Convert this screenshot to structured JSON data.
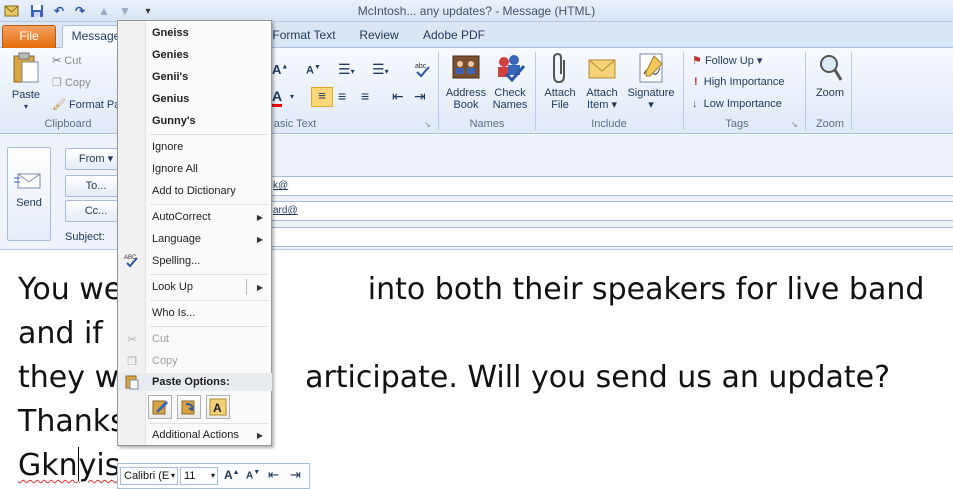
{
  "window": {
    "title": "McIntosh... any updates? - Message (HTML)"
  },
  "tabs": [
    "File",
    "Message",
    "Format Text",
    "Review",
    "Adobe PDF"
  ],
  "ribbon": {
    "clipboard": {
      "paste": "Paste",
      "cut": "Cut",
      "copy": "Copy",
      "format_painter": "Format Pa",
      "label": "Clipboard"
    },
    "basic_text": {
      "label": "asic Text"
    },
    "names": {
      "address_book": [
        "Address",
        "Book"
      ],
      "check_names": [
        "Check",
        "Names"
      ],
      "label": "Names"
    },
    "include": {
      "attach_file": [
        "Attach",
        "File"
      ],
      "attach_item": [
        "Attach",
        "Item ▾"
      ],
      "signature": [
        "Signature",
        "▾"
      ],
      "label": "Include"
    },
    "tags": {
      "follow_up": "Follow Up ▾",
      "high_importance": "High Importance",
      "low_importance": "Low Importance",
      "label": "Tags"
    },
    "zoom": {
      "zoom": "Zoom",
      "label": "Zoom"
    }
  },
  "header": {
    "send": "Send",
    "from": "From ▾",
    "to": "To...",
    "cc": "Cc...",
    "subject_label": "Subject:",
    "to_value": "k@",
    "cc_value": "ard@"
  },
  "body": {
    "line1a": "You we",
    "line1b": " into both their speakers for live band and if",
    "line2a": "they w",
    "line2b": "articipate. Will you send us an update?",
    "line3": "Thanks",
    "line4a": "Gkn",
    "line4b": "yis"
  },
  "context_menu": {
    "suggestions": [
      "Gneiss",
      "Genies",
      "Genii's",
      "Genius",
      "Gunny's"
    ],
    "ignore": "Ignore",
    "ignore_all": "Ignore All",
    "add_to_dictionary": "Add to Dictionary",
    "autocorrect": "AutoCorrect",
    "language": "Language",
    "spelling": "Spelling...",
    "look_up": "Look Up",
    "who_is": "Who Is...",
    "cut": "Cut",
    "copy": "Copy",
    "paste_options": "Paste Options:",
    "additional_actions": "Additional Actions"
  },
  "mini_toolbar": {
    "font": "Calibri (E",
    "size": "11"
  }
}
